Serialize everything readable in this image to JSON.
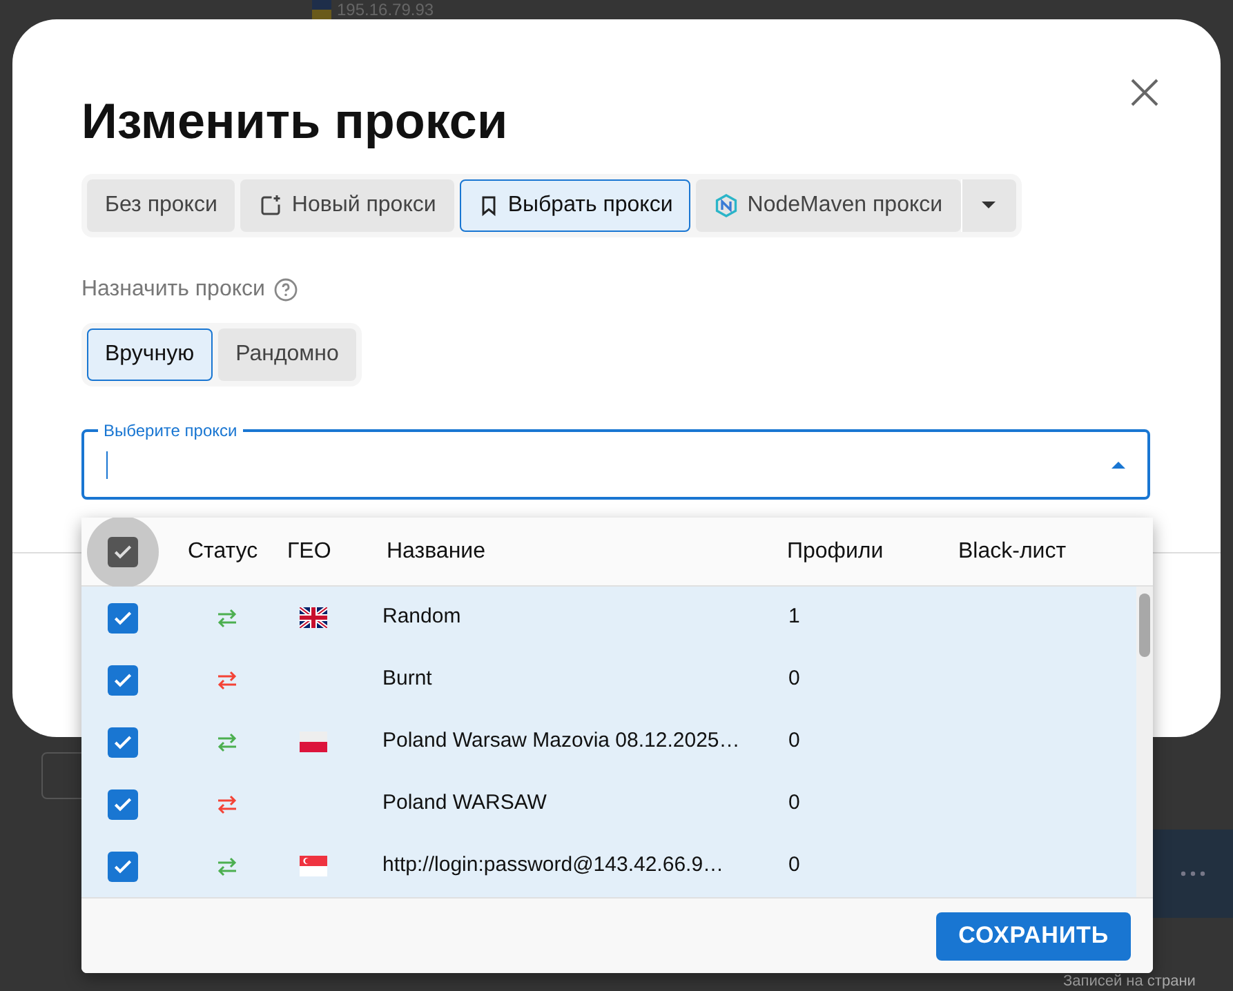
{
  "background": {
    "ip_text": "195.16.79.93",
    "footer_text": "Записей на страни"
  },
  "dialog": {
    "title": "Изменить прокси",
    "tabs": [
      {
        "label": "Без прокси",
        "selected": false,
        "kind": "plain"
      },
      {
        "label": "Новый прокси",
        "selected": false,
        "kind": "add"
      },
      {
        "label": "Выбрать прокси",
        "selected": true,
        "kind": "bookmark"
      },
      {
        "label": "NodeMaven прокси",
        "selected": false,
        "kind": "logo"
      }
    ],
    "assign": {
      "label": "Назначить прокси",
      "options": [
        {
          "label": "Вручную",
          "selected": true
        },
        {
          "label": "Рандомно",
          "selected": false
        }
      ]
    },
    "select": {
      "label": "Выберите прокси",
      "expanded": true
    }
  },
  "dropdown": {
    "select_all": {
      "checked": true
    },
    "columns": [
      "Статус",
      "ГЕО",
      "Название",
      "Профили",
      "Black-лист"
    ],
    "rows": [
      {
        "checked": true,
        "color": "#4caf50",
        "kind": "ukflag",
        "name": "Random",
        "profiles": "1"
      },
      {
        "checked": true,
        "color": "#f44336",
        "kind": "noflag",
        "name": "Burnt",
        "profiles": "0"
      },
      {
        "checked": true,
        "color": "#4caf50",
        "kind": "polandflag",
        "name": "Poland Warsaw Mazovia 08.12.2025…",
        "profiles": "0"
      },
      {
        "checked": true,
        "color": "#f44336",
        "kind": "noflag",
        "name": "Poland WARSAW",
        "profiles": "0"
      },
      {
        "checked": true,
        "color": "#4caf50",
        "kind": "singaporeflag",
        "name": "http://login:password@143.42.66.9…",
        "profiles": "0"
      }
    ],
    "save_button": "СОХРАНИТЬ"
  }
}
